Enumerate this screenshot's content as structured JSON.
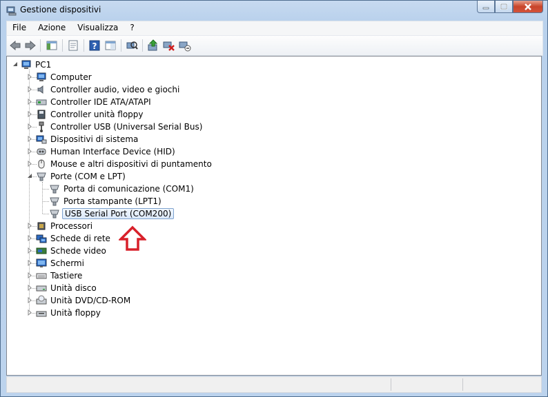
{
  "window": {
    "title": "Gestione dispositivi"
  },
  "menu": [
    "File",
    "Azione",
    "Visualizza",
    "?"
  ],
  "toolbar": [
    {
      "icon": "back-icon"
    },
    {
      "icon": "forward-icon"
    },
    {
      "icon": "tree-view-icon"
    },
    {
      "icon": "properties-icon"
    },
    {
      "icon": "help-icon"
    },
    {
      "icon": "console-icon"
    },
    {
      "icon": "scan-hardware-icon"
    },
    {
      "icon": "update-driver-icon"
    },
    {
      "icon": "uninstall-icon"
    },
    {
      "icon": "disable-icon"
    }
  ],
  "tree": {
    "root": "PC1",
    "categories": [
      {
        "label": "Computer",
        "icon": "computer-icon"
      },
      {
        "label": "Controller audio, video e giochi",
        "icon": "speaker-icon"
      },
      {
        "label": "Controller IDE ATA/ATAPI",
        "icon": "ide-controller-icon"
      },
      {
        "label": "Controller unità floppy",
        "icon": "floppy-controller-icon"
      },
      {
        "label": "Controller USB (Universal Serial Bus)",
        "icon": "usb-icon"
      },
      {
        "label": "Dispositivi di sistema",
        "icon": "system-device-icon"
      },
      {
        "label": "Human Interface Device (HID)",
        "icon": "hid-icon"
      },
      {
        "label": "Mouse e altri dispositivi di puntamento",
        "icon": "mouse-icon"
      },
      {
        "label": "Porte (COM e LPT)",
        "icon": "port-icon",
        "expanded": true,
        "children": [
          {
            "label": "Porta di comunicazione (COM1)",
            "icon": "port-icon"
          },
          {
            "label": "Porta stampante (LPT1)",
            "icon": "port-icon"
          },
          {
            "label": "USB Serial Port (COM200)",
            "icon": "port-icon",
            "selected": true
          }
        ]
      },
      {
        "label": "Processori",
        "icon": "processor-icon"
      },
      {
        "label": "Schede di rete",
        "icon": "network-adapter-icon"
      },
      {
        "label": "Schede video",
        "icon": "display-adapter-icon"
      },
      {
        "label": "Schermi",
        "icon": "monitor-icon"
      },
      {
        "label": "Tastiere",
        "icon": "keyboard-icon"
      },
      {
        "label": "Unità disco",
        "icon": "disk-drive-icon"
      },
      {
        "label": "Unità DVD/CD-ROM",
        "icon": "dvd-drive-icon"
      },
      {
        "label": "Unità floppy",
        "icon": "floppy-drive-icon"
      }
    ]
  },
  "colors": {
    "annotation_arrow": "#d8202a",
    "selection": "#dbe9fa"
  }
}
